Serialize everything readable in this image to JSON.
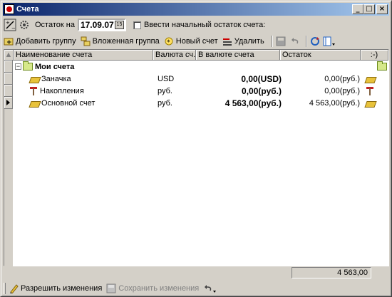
{
  "window": {
    "title": "Счета"
  },
  "toolbar1": {
    "balance_label": "Остаток на",
    "date_value": "17.09.07",
    "calendar_glyph": "15",
    "initial_balance_label": "Ввести начальный остаток счета:"
  },
  "toolbar2": {
    "add_group": "Добавить группу",
    "nested_group": "Вложенная группа",
    "new_account": "Новый счет",
    "delete": "Удалить"
  },
  "grid": {
    "columns": [
      "Наименование счета",
      "Валюта сч...",
      "В валюте счета",
      "Остаток",
      ":-)"
    ],
    "group": {
      "name": "Мои счета"
    },
    "rows": [
      {
        "name": "Заначка",
        "currency": "USD",
        "in_currency": "0,00(USD)",
        "balance": "0,00(руб.)",
        "icon": "gold-icon"
      },
      {
        "name": "Накопления",
        "currency": "руб.",
        "in_currency": "0,00(руб.)",
        "balance": "0,00(руб.)",
        "icon": "pickaxe-icon"
      },
      {
        "name": "Основной счет",
        "currency": "руб.",
        "in_currency": "4 563,00(руб.)",
        "balance": "4 563,00(руб.)",
        "icon": "gold-icon"
      }
    ],
    "total": "4 563,00"
  },
  "toolbar3": {
    "allow_changes": "Разрешить изменения",
    "save_changes": "Сохранить изменения"
  }
}
